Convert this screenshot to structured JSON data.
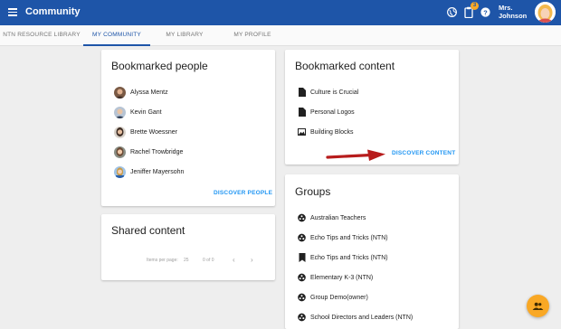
{
  "app": {
    "title": "Community"
  },
  "header": {
    "notification_count": "3",
    "user_name": "Mrs. Johnson"
  },
  "tabs": [
    {
      "label": "NTN RESOURCE LIBRARY",
      "active": false
    },
    {
      "label": "MY COMMUNITY",
      "active": true
    },
    {
      "label": "MY LIBRARY",
      "active": false
    },
    {
      "label": "MY PROFILE",
      "active": false
    }
  ],
  "bookmarked_people": {
    "title": "Bookmarked people",
    "people": [
      {
        "name": "Alyssa Mentz"
      },
      {
        "name": "Kevin Gant"
      },
      {
        "name": "Brette Woessner"
      },
      {
        "name": "Rachel Trowbridge"
      },
      {
        "name": "Jeniffer Mayersohn"
      }
    ],
    "action": "DISCOVER PEOPLE"
  },
  "shared_content": {
    "title": "Shared content",
    "items_per_page_label": "Items per page:",
    "items_per_page": "25",
    "range": "0 of 0"
  },
  "bookmarked_content": {
    "title": "Bookmarked content",
    "items": [
      {
        "label": "Culture is Crucial",
        "icon": "document-icon"
      },
      {
        "label": "Personal Logos",
        "icon": "document-icon"
      },
      {
        "label": "Building Blocks",
        "icon": "image-icon"
      }
    ],
    "action": "DISCOVER CONTENT"
  },
  "groups": {
    "title": "Groups",
    "items": [
      {
        "label": "Australian Teachers",
        "icon": "group-icon"
      },
      {
        "label": "Echo Tips and Tricks (NTN)",
        "icon": "group-icon"
      },
      {
        "label": "Echo Tips and Tricks (NTN)",
        "icon": "bookmark-icon"
      },
      {
        "label": "Elementary K-3 (NTN)",
        "icon": "group-icon"
      },
      {
        "label": "Group Demo(owner)",
        "icon": "group-icon"
      },
      {
        "label": "School Directors and Leaders (NTN)",
        "icon": "group-icon"
      }
    ]
  },
  "colors": {
    "appbar": "#1e55a8",
    "accent_link": "#2196f3",
    "fab": "#f9a825",
    "annotation_arrow": "#b71c1c"
  }
}
